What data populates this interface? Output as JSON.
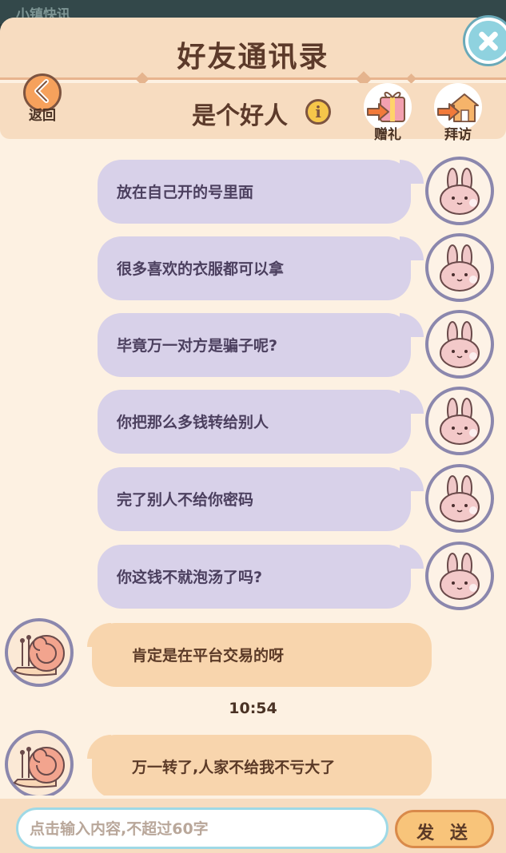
{
  "status_strip": {
    "text": "小镇快讯"
  },
  "header": {
    "title": "好友通讯录"
  },
  "subbar": {
    "back_label": "返回",
    "friend_name": "是个好人",
    "info_glyph": "i",
    "gift_label": "赠礼",
    "visit_label": "拜访"
  },
  "messages": [
    {
      "side": "right",
      "text": "放在自己开的号里面"
    },
    {
      "side": "right",
      "text": "很多喜欢的衣服都可以拿"
    },
    {
      "side": "right",
      "text": "毕竟万一对方是骗子呢?"
    },
    {
      "side": "right",
      "text": "你把那么多钱转给别人"
    },
    {
      "side": "right",
      "text": "完了别人不给你密码"
    },
    {
      "side": "right",
      "text": "你这钱不就泡汤了吗?"
    },
    {
      "side": "left",
      "text": "肯定是在平台交易的呀"
    },
    {
      "side": "left",
      "text": "万一转了,人家不给我不亏大了"
    }
  ],
  "timestamp": "10:54",
  "composer": {
    "placeholder": "点击输入内容,不超过60字",
    "send_label": "发 送"
  },
  "colors": {
    "panel_bg": "#fdf1e2",
    "header_bg": "#f7dcc0",
    "bubble_right": "#d8d1e9",
    "bubble_left": "#f8d5ad",
    "avatar_ring": "#8b87ad",
    "send_button": "#f8c47a"
  },
  "icons": {
    "close": "close-icon",
    "back": "chevron-left-icon",
    "info": "info-icon",
    "gift": "gift-icon",
    "visit": "house-icon",
    "friend_avatar": "bunny-icon",
    "self_avatar": "snail-icon"
  }
}
